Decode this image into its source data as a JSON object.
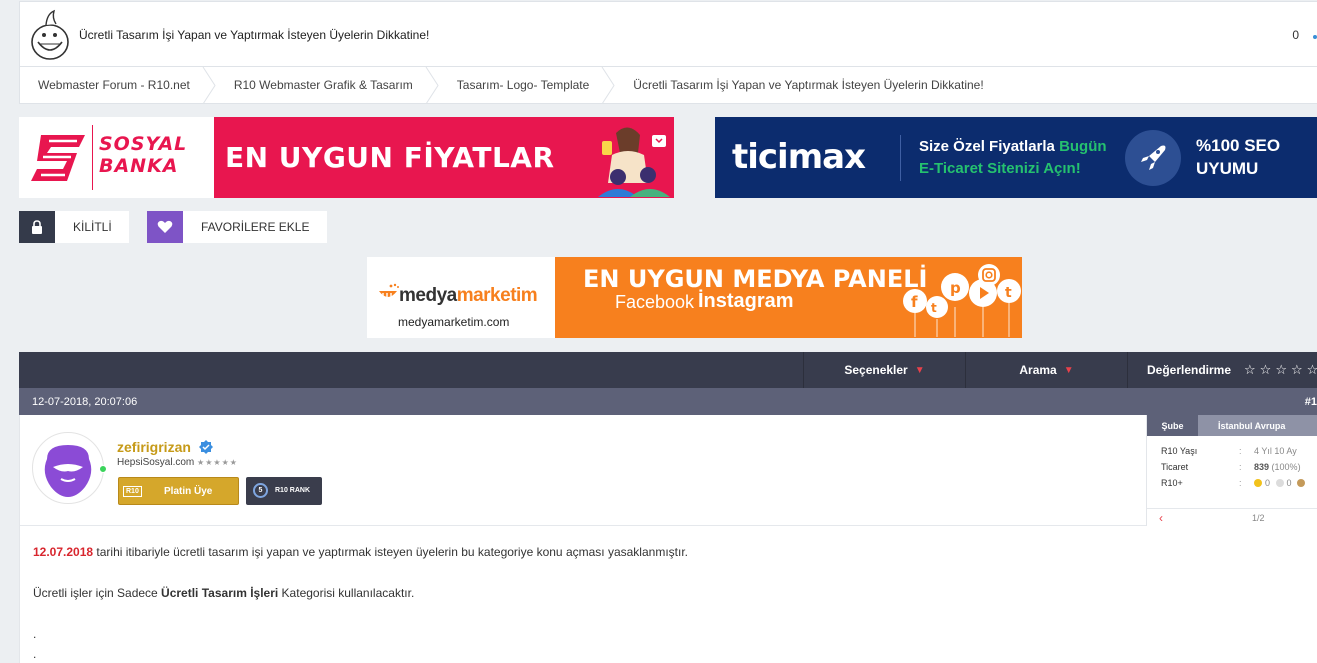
{
  "header": {
    "title": "Ücretli Tasarım İşi Yapan ve Yaptırmak İsteyen Üyelerin Dikkatine!",
    "count": "0"
  },
  "breadcrumb": [
    "Webmaster Forum - R10.net",
    "R10 Webmaster Grafik & Tasarım",
    "Tasarım- Logo- Template",
    "Ücretli Tasarım İşi Yapan ve Yaptırmak İsteyen Üyelerin Dikkatine!"
  ],
  "ads": {
    "sosyal_banka": {
      "brand_line1": "SOSYAL",
      "brand_line2": "BANKA",
      "headline": "EN UYGUN FİYATLAR",
      "color": "#e8164f"
    },
    "ticimax": {
      "logo": "ticimax",
      "line1_a": "Size Özel Fiyatlarla ",
      "line1_b": "Bugün",
      "line2": "E-Ticaret Sitenizi Açın!",
      "seo1": "%100 SEO",
      "seo2": "UYUMU",
      "color": "#0c2c6e"
    },
    "medyamarketim": {
      "brand_a": "medya",
      "brand_b": "marketim",
      "url": "medyamarketim.com",
      "headline": "EN UYGUN MEDYA PANELİ",
      "sub_a": "Facebook",
      "sub_b": "İnstagram",
      "color": "#f7801e"
    }
  },
  "buttons": {
    "lock_label": "KİLİTLİ",
    "fav_label": "FAVORİLERE EKLE"
  },
  "thread_bar": {
    "options": "Seçenekler",
    "search": "Arama",
    "rating": "Değerlendirme",
    "stars": "☆☆☆☆☆"
  },
  "post": {
    "date": "12-07-2018, 20:07:06",
    "number": "#1",
    "user": {
      "name": "zefirigrizan",
      "sub": "HepsiSosyal.com",
      "sub_stars": "★★★★★",
      "badge_prefix": "R10",
      "badge": "Platin Üye",
      "rank_num": "5",
      "rank": "R10 RANK"
    },
    "stats": {
      "branch_label": "Şube",
      "branch_value": "İstanbul Avrupa",
      "rows": [
        {
          "k": "R10 Yaşı",
          "v": "4 Yıl 10 Ay"
        },
        {
          "k": "Ticaret",
          "v_bold": "839",
          "v": "(100%)"
        },
        {
          "k": "R10+",
          "v1": "0",
          "v2": "0"
        }
      ],
      "page": "1/2"
    },
    "content": {
      "date_red": "12.07.2018",
      "line1": " tarihi itibariyle ücretli tasarım işi yapan ve yaptırmak isteyen üyelerin bu kategoriye konu açması yasaklanmıştır.",
      "line2_a": "Ücretli işler için Sadece ",
      "line2_b": "Ücretli Tasarım İşleri",
      "line2_c": " Kategorisi kullanılacaktır.",
      "dot1": ".",
      "dot2": "."
    }
  }
}
